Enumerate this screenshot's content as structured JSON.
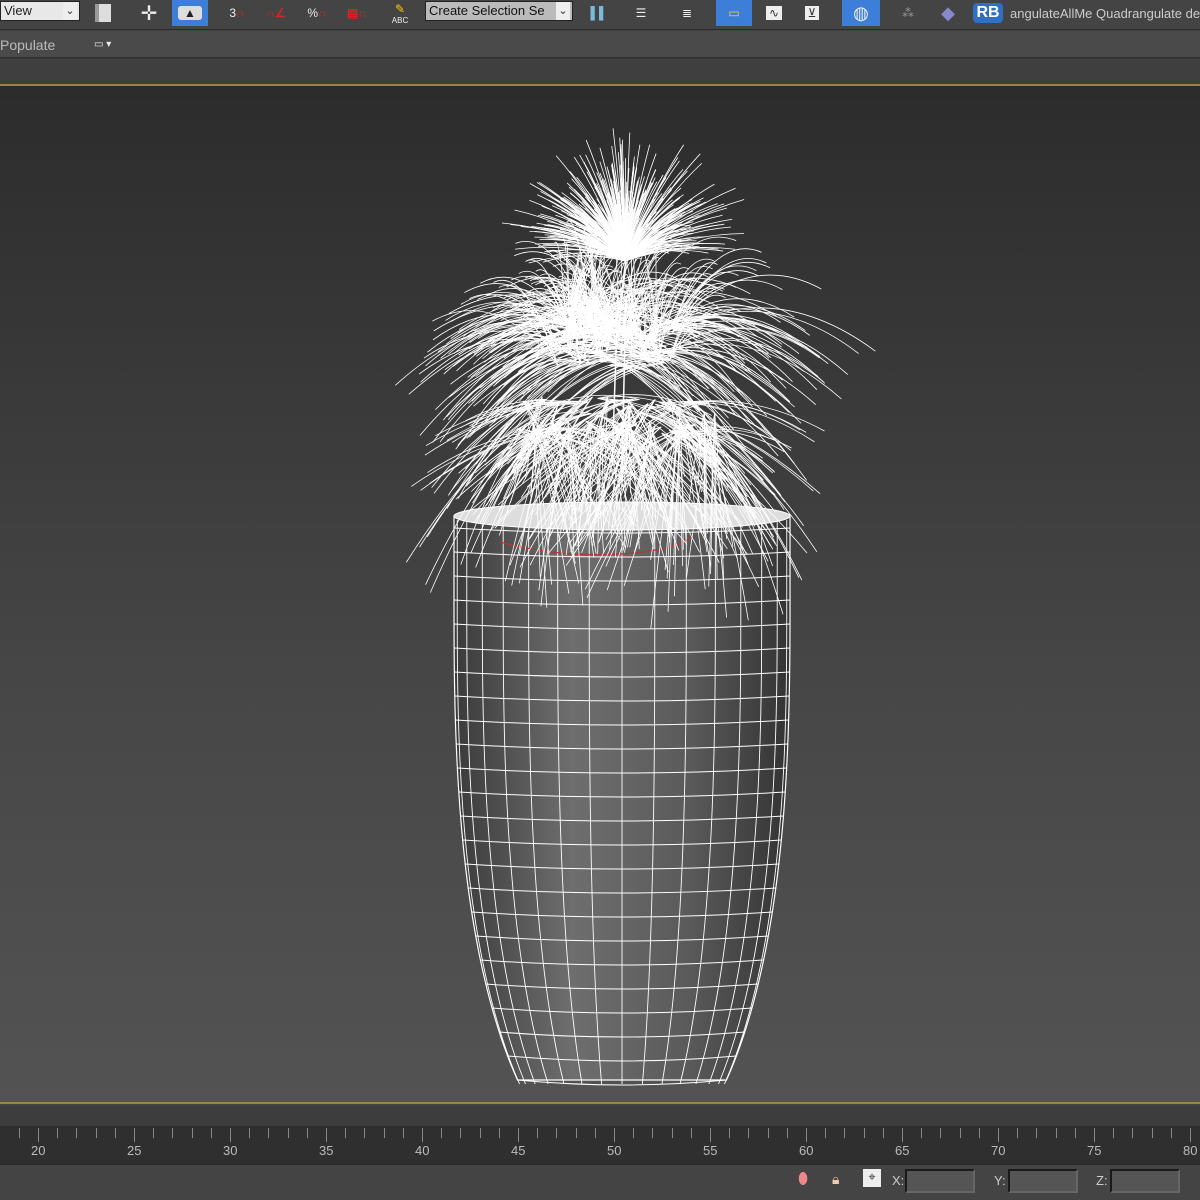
{
  "toolbar": {
    "view_dropdown": "View",
    "selection_set_dropdown": "Create Selection Se",
    "rb_label": "RB",
    "script_text": "angulateAllMe Quadrangulate de",
    "snap_3d_label": "3",
    "percent_label": "%",
    "abc_label": "ABC"
  },
  "ribbon": {
    "populate_label": "Populate"
  },
  "timeline": {
    "frame_labels": [
      "20",
      "25",
      "30",
      "35",
      "40",
      "45",
      "50",
      "55",
      "60",
      "65",
      "70",
      "75",
      "80"
    ]
  },
  "status": {
    "x_label": "X:",
    "y_label": "Y:",
    "z_label": "Z:",
    "x_value": "",
    "y_value": "",
    "z_value": ""
  },
  "colors": {
    "accent": "#3d7fd8",
    "viewport_border": "#9b8440"
  }
}
